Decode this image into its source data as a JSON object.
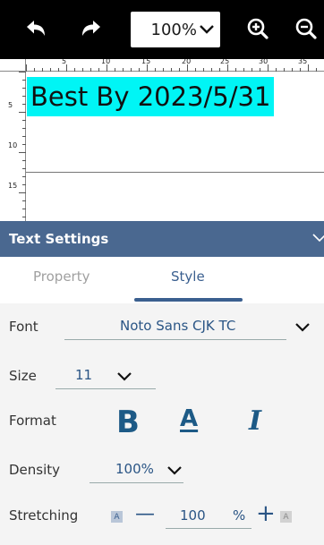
{
  "toolbar": {
    "zoom_value": "100%",
    "icons": [
      "undo-icon",
      "redo-icon",
      "chevron-down-icon",
      "zoom-in-icon",
      "zoom-out-icon"
    ]
  },
  "canvas": {
    "ruler_top_labels": [
      "5",
      "10",
      "15",
      "20",
      "25",
      "30",
      "35"
    ],
    "ruler_left_labels": [
      "5",
      "10",
      "15"
    ],
    "label_text": "Best By 2023/5/31",
    "label_highlight_color": "#00f5f5"
  },
  "panel": {
    "title": "Text Settings",
    "header_color": "#4a6890"
  },
  "tabs": {
    "property": "Property",
    "style": "Style",
    "active": "Style"
  },
  "style": {
    "font_label": "Font",
    "font_value": "Noto Sans CJK TC",
    "size_label": "Size",
    "size_value": "11",
    "format_label": "Format",
    "format_bold": "B",
    "format_underline": "A",
    "format_italic": "I",
    "density_label": "Density",
    "density_value": "100%",
    "stretching_label": "Stretching",
    "stretching_small_icon": "A",
    "stretching_minus": "—",
    "stretching_value": "100",
    "stretching_unit": "%",
    "stretching_plus": "+",
    "stretching_large_icon": "A"
  },
  "colors": {
    "accent": "#2a5585",
    "format_icons": "#1d5a86"
  }
}
